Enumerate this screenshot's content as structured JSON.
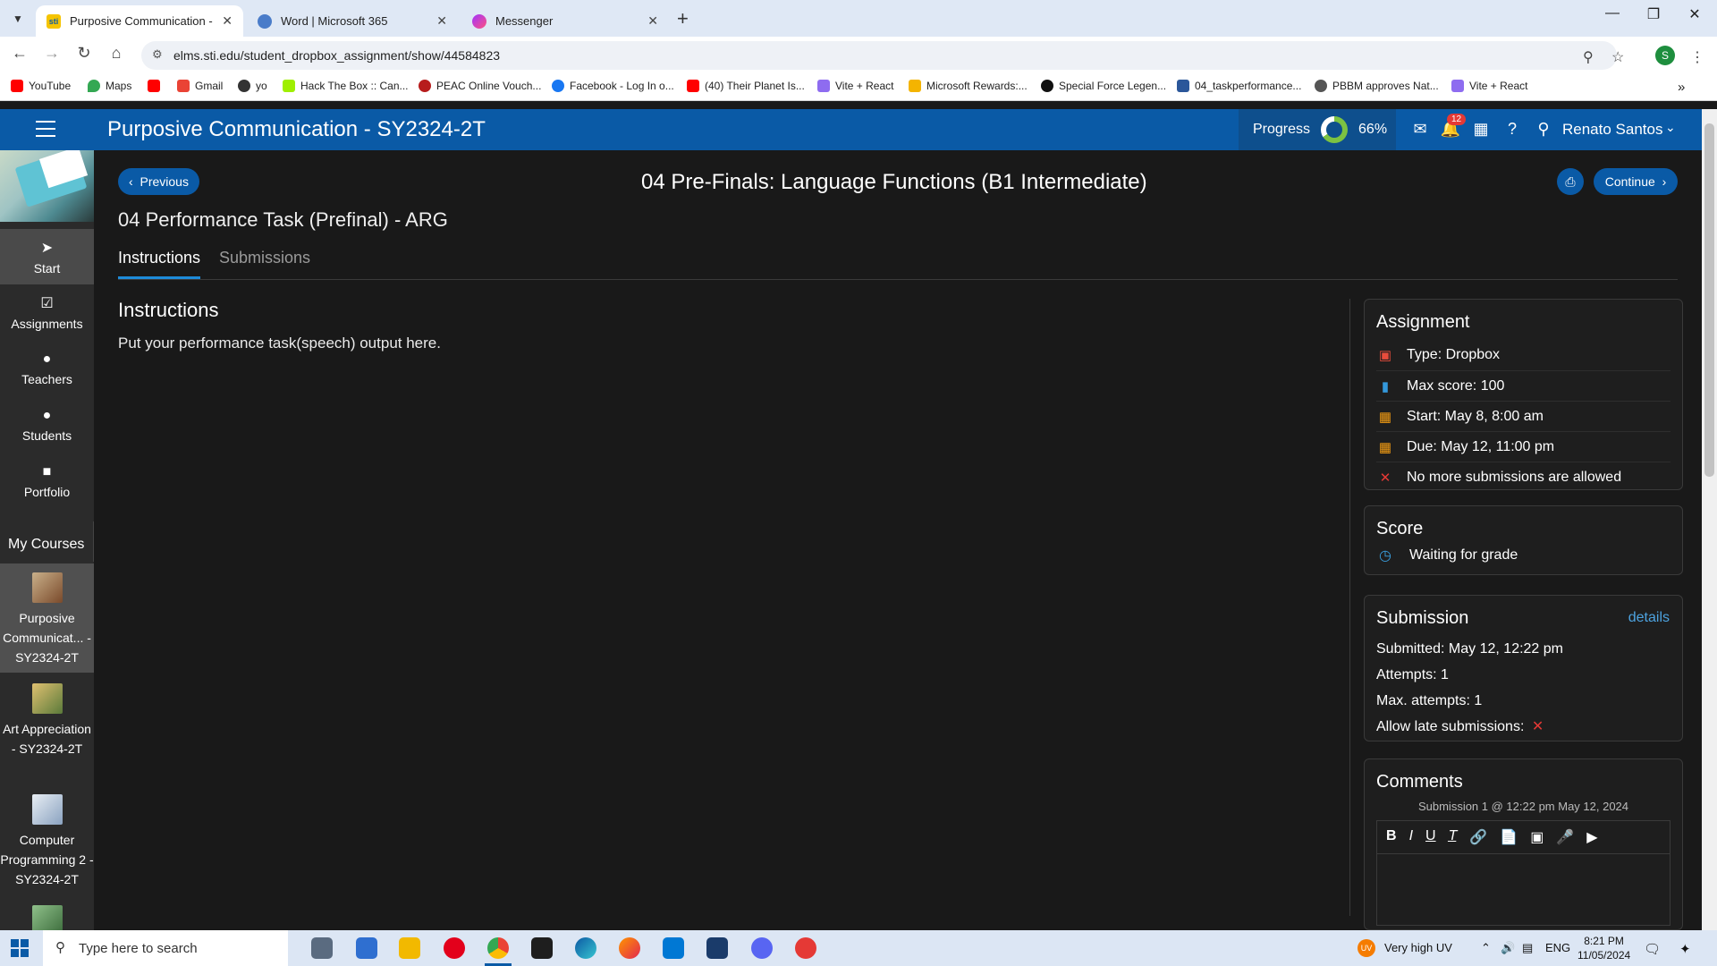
{
  "browser": {
    "tabs": [
      {
        "title": "Purposive Communication - SY",
        "icon": "sti-favicon",
        "active": true
      },
      {
        "title": "Word | Microsoft 365",
        "icon": "m365-favicon",
        "active": false
      },
      {
        "title": "Messenger",
        "icon": "messenger-favicon",
        "active": false
      }
    ],
    "url": "elms.sti.edu/student_dropbox_assignment/show/44584823",
    "profile_initial": "S",
    "bookmarks": [
      {
        "label": "YouTube",
        "color": "#ff0000"
      },
      {
        "label": "Maps",
        "color": "#34a853"
      },
      {
        "label": "",
        "color": "#ff0000"
      },
      {
        "label": "Gmail",
        "color": "#ea4335"
      },
      {
        "label": "yo",
        "color": "#333333"
      },
      {
        "label": "Hack The Box :: Can...",
        "color": "#9fef00"
      },
      {
        "label": "PEAC Online Vouch...",
        "color": "#b71c1c"
      },
      {
        "label": "Facebook - Log In o...",
        "color": "#1877f2"
      },
      {
        "label": "(40) Their Planet Is...",
        "color": "#ff0000"
      },
      {
        "label": "Vite + React",
        "color": "#8e6cf0"
      },
      {
        "label": "Microsoft Rewards:...",
        "color": "#f4b400"
      },
      {
        "label": "Special Force Legen...",
        "color": "#111111"
      },
      {
        "label": "04_taskperformance...",
        "color": "#2b579a"
      },
      {
        "label": "PBBM approves Nat...",
        "color": "#555555"
      },
      {
        "label": "Vite + React",
        "color": "#8e6cf0"
      }
    ]
  },
  "header": {
    "course_title": "Purposive Communication - SY2324-2T",
    "progress_label": "Progress",
    "progress_percent": "66%",
    "progress_value": 0.66,
    "notification_count": "12",
    "user_name": "Renato Santos"
  },
  "sidebar": {
    "nav": [
      {
        "label": "Start",
        "icon": "navigate-arrow-icon",
        "active": true
      },
      {
        "label": "Assignments",
        "icon": "checkbox-icon",
        "active": false
      },
      {
        "label": "Teachers",
        "icon": "person-icon",
        "active": false
      },
      {
        "label": "Students",
        "icon": "person-icon",
        "active": false
      },
      {
        "label": "Portfolio",
        "icon": "folder-icon",
        "active": false
      }
    ],
    "my_courses_label": "My Courses",
    "courses": [
      {
        "label": "Purposive Communicat... - SY2324-2T",
        "active": true
      },
      {
        "label": "Art Appreciation - SY2324-2T",
        "active": false
      },
      {
        "label": "Computer Programming 2 - SY2324-2T",
        "active": false
      }
    ]
  },
  "main": {
    "prev_label": "Previous",
    "continue_label": "Continue",
    "lesson_title": "04 Pre-Finals: Language Functions (B1 Intermediate)",
    "task_title": "04 Performance Task (Prefinal) - ARG",
    "tabs": [
      {
        "label": "Instructions",
        "active": true
      },
      {
        "label": "Submissions",
        "active": false
      }
    ],
    "instructions_heading": "Instructions",
    "instructions_body": "Put your performance task(speech) output here."
  },
  "assignment": {
    "heading": "Assignment",
    "rows": [
      {
        "text": "Type: Dropbox",
        "icon": "dropbox-icon",
        "color": "#e74c3c"
      },
      {
        "text": "Max score: 100",
        "icon": "bar-chart-icon",
        "color": "#3498db"
      },
      {
        "text": "Start: May 8, 8:00 am",
        "icon": "calendar-icon",
        "color": "#f39c12"
      },
      {
        "text": "Due: May 12, 11:00 pm",
        "icon": "calendar-icon",
        "color": "#f39c12"
      },
      {
        "text": "No more submissions are allowed",
        "icon": "close-icon",
        "color": "#e53935"
      }
    ]
  },
  "score": {
    "heading": "Score",
    "status": "Waiting for grade"
  },
  "submission": {
    "heading": "Submission",
    "details_label": "details",
    "submitted": "Submitted: May 12, 12:22 pm",
    "attempts": "Attempts: 1",
    "max_attempts": "Max. attempts: 1",
    "late_label": "Allow late submissions:"
  },
  "comments": {
    "heading": "Comments",
    "meta": "Submission 1 @ 12:22 pm May 12, 2024"
  },
  "taskbar": {
    "search_placeholder": "Type here to search",
    "weather": "Very high UV",
    "weather_badge": "UV",
    "language": "ENG",
    "time": "8:21 PM",
    "date": "11/05/2024"
  }
}
